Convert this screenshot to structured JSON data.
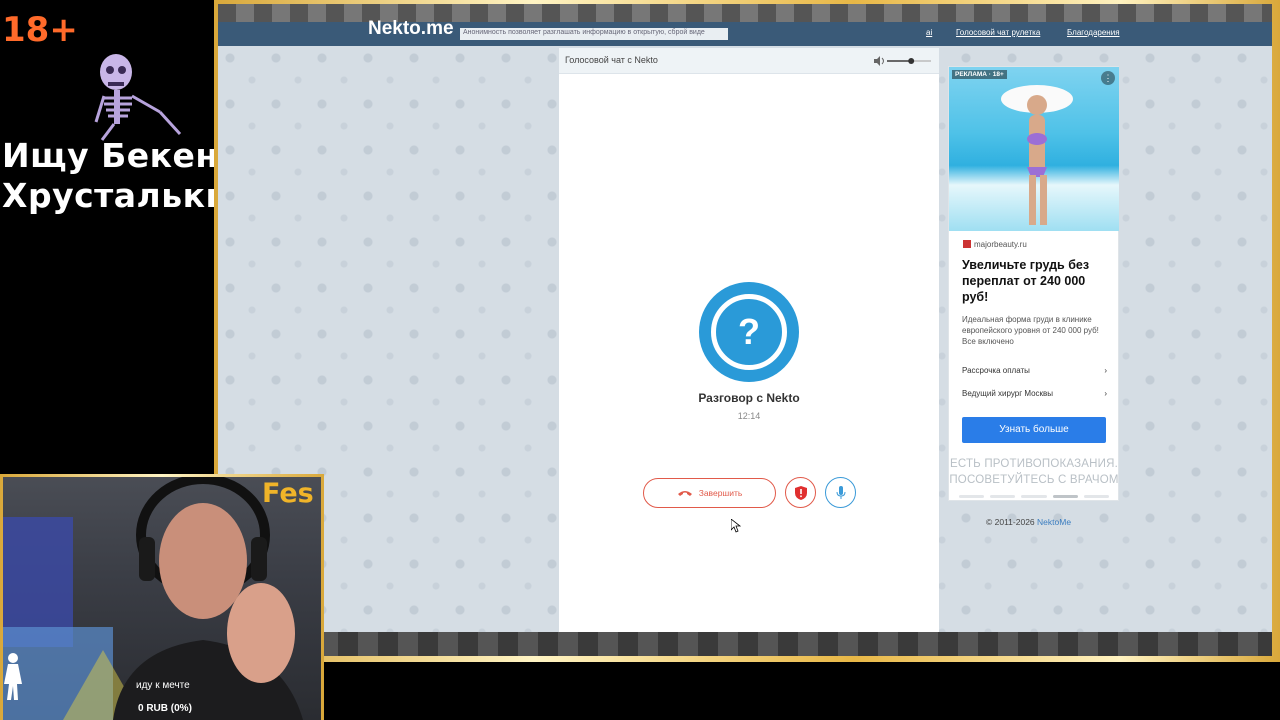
{
  "overlay": {
    "age_badge": "18+",
    "title_line1": "Ищу Бекенг",
    "title_line2": "Хрустальки",
    "streamer_name": "Fes",
    "goal_text": "иду к мечте",
    "donation_progress": "0 RUB (0%)"
  },
  "site": {
    "logo": "Nekto.me",
    "tagline": "Анонимность позволяет разглашать информацию в открытую, сброй виде",
    "links": [
      "Голосовой чат рулетка",
      "Благодарения"
    ]
  },
  "chat": {
    "title": "Голосовой чат с Nekto",
    "avatar_symbol": "?",
    "conversation_name": "Разговор с Nekto",
    "timer": "12:14",
    "end_button_label": "Завершить",
    "volume_level": 0.55
  },
  "ad": {
    "label": "РЕКЛАМА · 18+",
    "domain": "majorbeauty.ru",
    "headline": "Увеличьте грудь без переплат от 240 000 руб!",
    "body": "Идеальная форма груди в клинике европейского уровня от 240 000 руб! Все включено",
    "links": [
      "Рассрочка оплаты",
      "Ведущий хирург Москвы"
    ],
    "cta": "Узнать больше",
    "warning_line1": "ЕСТЬ ПРОТИВОПОКАЗАНИЯ.",
    "warning_line2": "ПОСОВЕТУЙТЕСЬ С ВРАЧОМ"
  },
  "footer": {
    "copyright_prefix": "© 2011-2026",
    "copyright_link": "NektoMe"
  },
  "colors": {
    "accent_blue": "#2a9ad8",
    "danger_red": "#e15a4a",
    "cta_blue": "#2a7de8",
    "overlay_orange": "#ff6a2a",
    "streamer_gold": "#f0b429"
  }
}
